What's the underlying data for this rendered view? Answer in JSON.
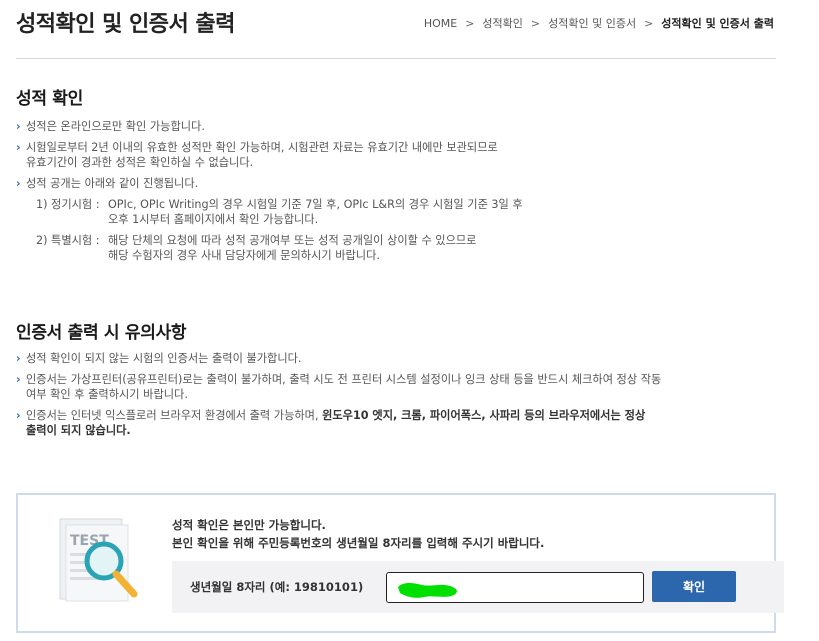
{
  "page": {
    "title": "성적확인 및 인증서 출력",
    "breadcrumb": [
      "HOME",
      "성적확인",
      "성적확인 및 인증서",
      "성적확인 및 인증서 출력"
    ]
  },
  "score_section": {
    "title": "성적 확인",
    "items": [
      "성적은 온라인으로만 확인 가능합니다.",
      "시험일로부터 2년 이내의 유효한 성적만 확인 가능하며, 시험관련 자료는 유효기간 내에만 보관되므로",
      "유효기간이 경과한 성적은 확인하실 수 없습니다.",
      "성적 공개는 아래와 같이 진행됩니다."
    ],
    "regular": {
      "label": "1) 정기시험 :",
      "line1": "OPIc, OPIc Writing의 경우 시험일 기준 7일 후, OPIc L&R의 경우 시험일 기준 3일 후",
      "line2": "오후 1시부터 홈페이지에서 확인 가능합니다."
    },
    "special": {
      "label": "2) 특별시험 :",
      "line1": "해당 단체의 요청에 따라 성적 공개여부 또는 성적 공개일이 상이할 수 있으므로",
      "line2": "해당 수험자의 경우 사내 담당자에게 문의하시기 바랍니다."
    }
  },
  "cert_section": {
    "title": "인증서 출력 시 유의사항",
    "item1": "성적 확인이 되지 않는 시험의 인증서는 출력이 불가합니다.",
    "item2_line1": "인증서는 가상프린터(공유프린터)로는 출력이 불가하며, 출력 시도 전 프린터 시스템 설정이나 잉크 상태 등을 반드시 체크하여 정상 작동",
    "item2_line2": "여부 확인 후 출력하시기 바랍니다.",
    "item3_normal": "인증서는 인터넷 익스플로러 브라우저 환경에서 출력 가능하며, ",
    "item3_bold1": "윈도우10 엣지, 크롬, 파이어폭스, 사파리 등의 브라우저에서는 정상",
    "item3_bold2": "출력이 되지 않습니다."
  },
  "verify": {
    "illustration_text": "TEST",
    "notice1": "성적 확인은 본인만 가능합니다.",
    "notice2": "본인 확인을 위해 주민등록번호의 생년월일 8자리를 입력해 주시기 바랍니다.",
    "dob_label": "생년월일 8자리 (예: 19810101)",
    "dob_value": "",
    "confirm_label": "확인"
  },
  "colors": {
    "accent": "#2a6fbd",
    "button": "#2c66ad",
    "box_border": "#cfdbe8",
    "input_area": "#f2f2f4",
    "scribble": "#00e000"
  }
}
